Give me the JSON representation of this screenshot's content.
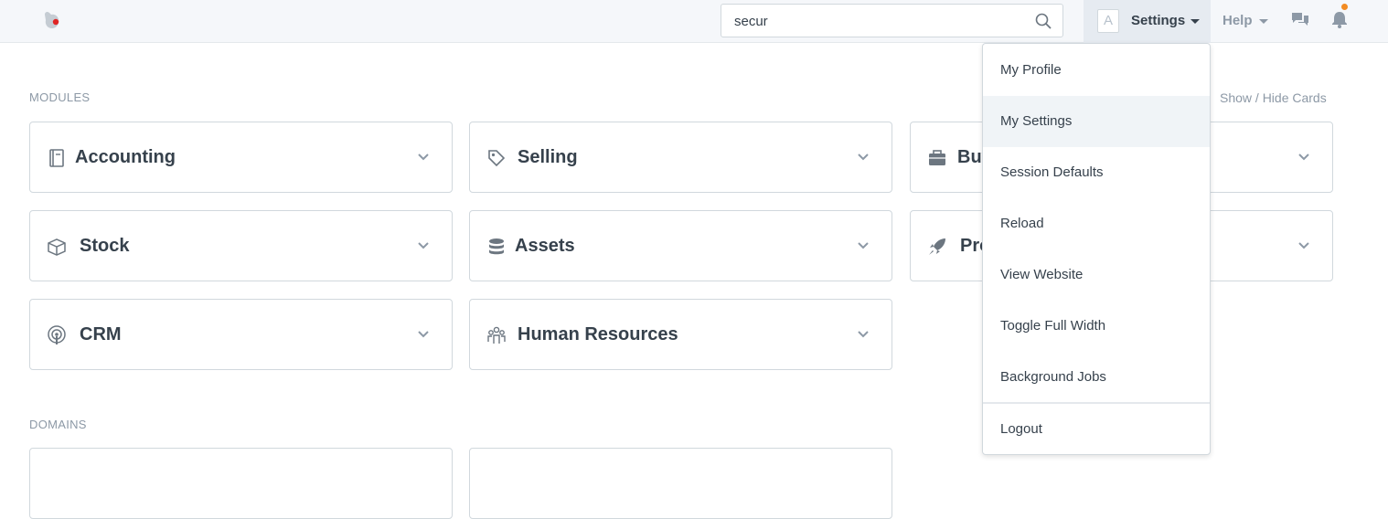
{
  "navbar": {
    "search": {
      "value": "secur",
      "placeholder": ""
    },
    "avatar_letter": "A",
    "settings_label": "Settings",
    "help_label": "Help"
  },
  "main": {
    "modules_label": "MODULES",
    "show_hide_label": "Show / Hide Cards",
    "cards": [
      {
        "label": "Accounting",
        "icon": "ledger-icon"
      },
      {
        "label": "Selling",
        "icon": "tag-icon"
      },
      {
        "label": "Buy",
        "icon": "briefcase-icon"
      },
      {
        "label": "Stock",
        "icon": "box-icon"
      },
      {
        "label": "Assets",
        "icon": "database-icon"
      },
      {
        "label": "Pro",
        "icon": "rocket-icon"
      },
      {
        "label": "CRM",
        "icon": "broadcast-icon"
      },
      {
        "label": "Human Resources",
        "icon": "people-icon"
      }
    ],
    "domains_label": "DOMAINS"
  },
  "settings_menu": {
    "items": [
      {
        "label": "My Profile"
      },
      {
        "label": "My Settings",
        "active": true
      },
      {
        "label": "Session Defaults"
      },
      {
        "label": "Reload"
      },
      {
        "label": "View Website"
      },
      {
        "label": "Toggle Full Width"
      },
      {
        "label": "Background Jobs"
      },
      {
        "label": "Logout"
      }
    ]
  },
  "colors": {
    "navbar_bg": "#f5f7fa",
    "text": "#36414c",
    "muted": "#8d99a6",
    "notification_dot": "#f28b23",
    "logo_red": "#e02424"
  }
}
